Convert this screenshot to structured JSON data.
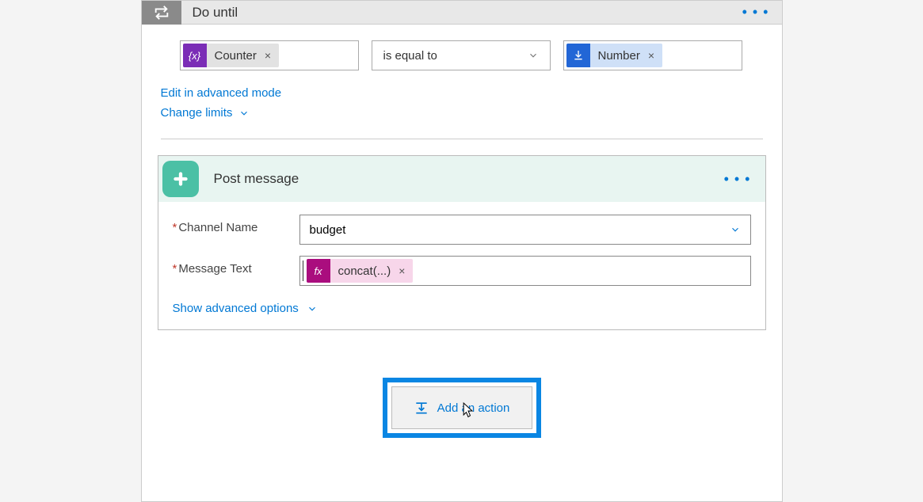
{
  "header": {
    "title": "Do until"
  },
  "condition": {
    "left_token": "Counter",
    "operator": "is equal to",
    "right_token": "Number"
  },
  "links": {
    "edit_advanced": "Edit in advanced mode",
    "change_limits": "Change limits"
  },
  "action": {
    "title": "Post message",
    "fields": {
      "channel_label": "Channel Name",
      "channel_value": "budget",
      "message_label": "Message Text",
      "message_token": "concat(...)"
    },
    "show_advanced": "Show advanced options"
  },
  "add_action": {
    "label": "Add an action"
  },
  "icons": {
    "variable": "{x}",
    "fx": "fx"
  }
}
